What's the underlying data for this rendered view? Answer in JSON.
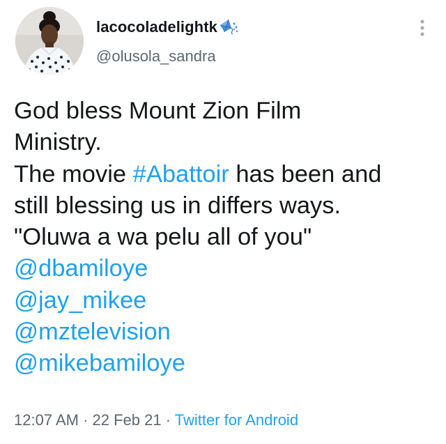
{
  "user": {
    "display_name": "lacocoladelightk",
    "handle": "@olusola_sandra",
    "badge_icon": "kite-icon"
  },
  "menu": {
    "icon": "more-vertical-icon"
  },
  "tweet": {
    "line1": "God bless Mount Zion Film",
    "line2": "Ministry.",
    "line3_pre": "The movie ",
    "hashtag": "#Abattoir",
    "line3_post": " has been and",
    "line4": "still blessing us in differs ways.",
    "line5": "\"Oluwa a wa pelu all of you\"",
    "mentions": [
      "@dbamiloye",
      "@jay_mikee",
      "@mztelevision",
      "@mikebamiloye"
    ]
  },
  "meta": {
    "time": "12:07 AM",
    "separator": " · ",
    "date": "22 Feb 21",
    "source": "Twitter for Android"
  },
  "colors": {
    "link": "#1da1f2",
    "text": "#14171a",
    "secondary": "#5b6770"
  }
}
